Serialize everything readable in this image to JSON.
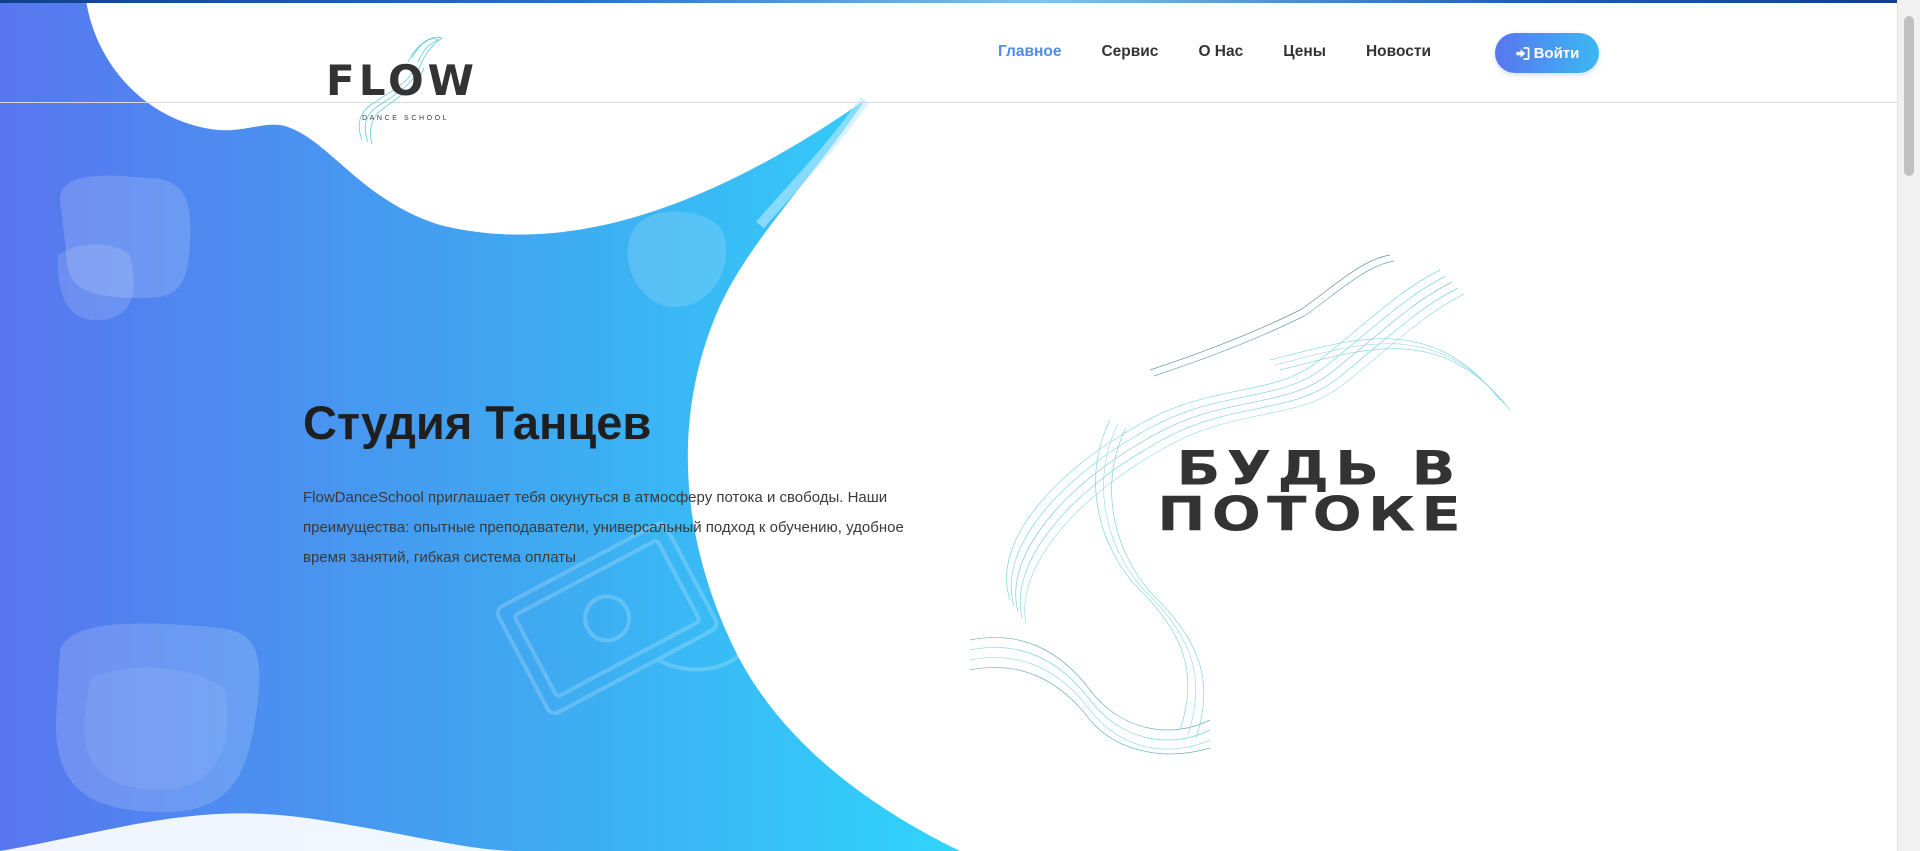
{
  "brand": {
    "logo_text": "FLOW",
    "logo_sub": "DANCE SCHOOL"
  },
  "nav": {
    "items": [
      {
        "label": "Главное",
        "active": true
      },
      {
        "label": "Сервис",
        "active": false
      },
      {
        "label": "О Нас",
        "active": false
      },
      {
        "label": "Цены",
        "active": false
      },
      {
        "label": "Новости",
        "active": false
      }
    ],
    "login_label": "Войти",
    "login_icon": "sign-in-icon"
  },
  "hero": {
    "title": "Студия Танцев",
    "text": "FlowDanceSchool приглашает тебя окунуться в атмосферу потока и свободы. Наши преимущества: опытные преподаватели, универсальный подход к обучению, удобное время занятий, гибкая система оплаты"
  },
  "slogan": {
    "line1": "БУДЬ В",
    "line2": "ПОТОКЕ"
  },
  "colors": {
    "accent": "#4e8ee6",
    "gradient_start": "#5876ef",
    "gradient_end": "#30d4fb",
    "text_dark": "#1f1f1f",
    "wave_teal": "#56c8d8"
  }
}
